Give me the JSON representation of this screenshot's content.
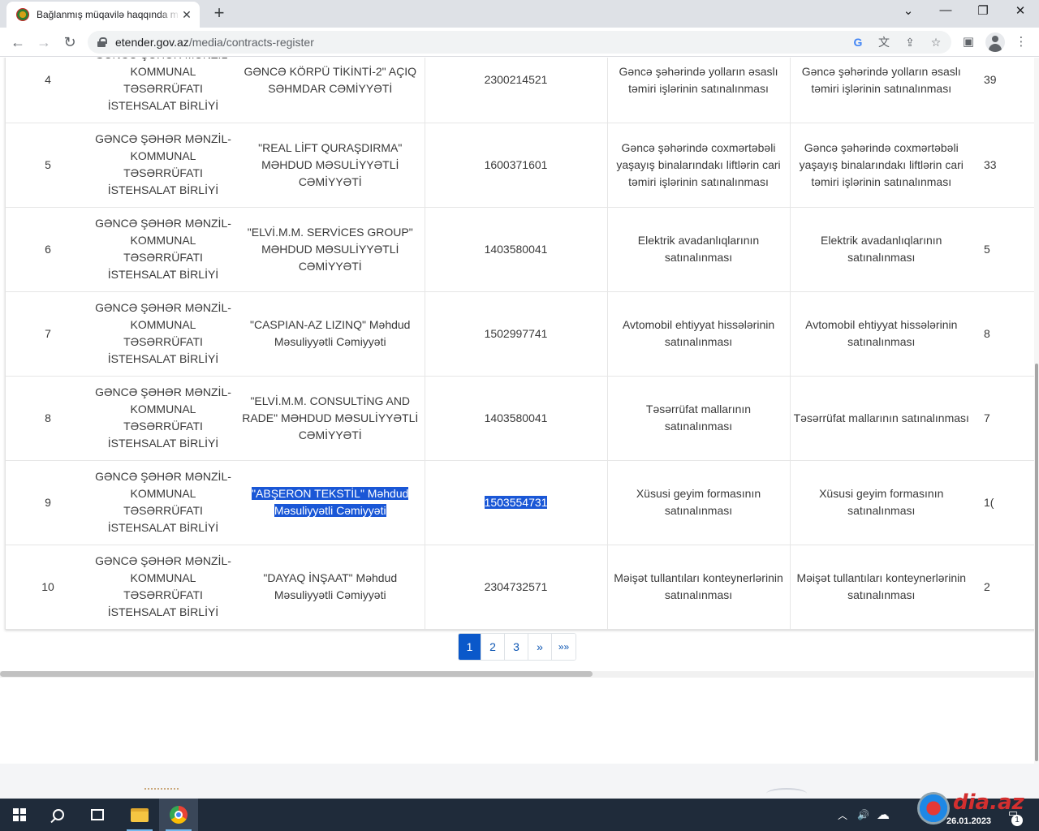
{
  "browser": {
    "tab_title": "Bağlanmış müqavilə haqqında m",
    "url_host": "etender.gov.az",
    "url_path": "/media/contracts-register",
    "close_glyph": "✕",
    "new_tab_glyph": "+",
    "minimize_glyph": "⌄",
    "min_glyph": "—",
    "restore_glyph": "❐",
    "window_close_glyph": "✕",
    "back_glyph": "←",
    "forward_glyph": "→",
    "reload_glyph": "↻",
    "menu_glyph": "⋮"
  },
  "rows": [
    {
      "num": "4",
      "customer": "GƏNCƏ ŞƏHƏR MƏNZİL-KOMMUNAL TƏSƏRRÜFATI İSTEHSALAT BİRLİYİ",
      "supplier": "GƏNCƏ KÖRPÜ TİKİNTİ-2\" AÇIQ SƏHMDAR CƏMİYYƏTİ",
      "voen": "2300214521",
      "subject": "Gəncə şəhərində yolların əsaslı təmiri işlərinin satınalınması",
      "description": "Gəncə şəhərində yolların əsaslı təmiri işlərinin satınalınması",
      "amount": "39"
    },
    {
      "num": "5",
      "customer": "GƏNCƏ ŞƏHƏR MƏNZİL-KOMMUNAL TƏSƏRRÜFATI İSTEHSALAT BİRLİYİ",
      "supplier": "\"REAL LİFT QURAŞDIRMA\" MƏHDUD MƏSULİYYƏTLİ CƏMİYYƏTİ",
      "voen": "1600371601",
      "subject": "Gəncə şəhərində coxmərtəbəli yaşayış binalarındakı liftlərin cari təmiri işlərinin satınalınması",
      "description": "Gəncə şəhərində coxmərtəbəli yaşayış binalarındakı liftlərin cari təmiri işlərinin satınalınması",
      "amount": "33"
    },
    {
      "num": "6",
      "customer": "GƏNCƏ ŞƏHƏR MƏNZİL-KOMMUNAL TƏSƏRRÜFATI İSTEHSALAT BİRLİYİ",
      "supplier": "\"ELVİ.M.M. SERVİCES GROUP\" MƏHDUD MƏSULİYYƏTLİ CƏMİYYƏTİ",
      "voen": "1403580041",
      "subject": "Elektrik avadanlıqlarının satınalınması",
      "description": "Elektrik avadanlıqlarının satınalınması",
      "amount": "5"
    },
    {
      "num": "7",
      "customer": "GƏNCƏ ŞƏHƏR MƏNZİL-KOMMUNAL TƏSƏRRÜFATI İSTEHSALAT BİRLİYİ",
      "supplier": "\"CASPIAN-AZ LIZINQ\" Məhdud Məsuliyyətli Cəmiyyəti",
      "voen": "1502997741",
      "subject": "Avtomobil ehtiyyat hissələrinin satınalınması",
      "description": "Avtomobil ehtiyyat hissələrinin satınalınması",
      "amount": "8"
    },
    {
      "num": "8",
      "customer": "GƏNCƏ ŞƏHƏR MƏNZİL-KOMMUNAL TƏSƏRRÜFATI İSTEHSALAT BİRLİYİ",
      "supplier": "\"ELVİ.M.M. CONSULTİNG AND RADE\" MƏHDUD MƏSULİYYƏTLİ CƏMİYYƏTİ",
      "voen": "1403580041",
      "subject": "Təsərrüfat mallarının satınalınması",
      "description": "Təsərrüfat mallarının satınalınması",
      "amount": "7"
    },
    {
      "num": "9",
      "customer": "GƏNCƏ ŞƏHƏR MƏNZİL-KOMMUNAL TƏSƏRRÜFATI İSTEHSALAT BİRLİYİ",
      "supplier": "\"ABŞERON TEKSTİL\" Məhdud Məsuliyyətli Cəmiyyəti",
      "voen": "1503554731",
      "subject": "Xüsusi geyim formasının satınalınması",
      "description": "Xüsusi geyim formasının satınalınması",
      "amount": "1("
    },
    {
      "num": "10",
      "customer": "GƏNCƏ ŞƏHƏR MƏNZİL-KOMMUNAL TƏSƏRRÜFATI İSTEHSALAT BİRLİYİ",
      "supplier": "\"DAYAQ İNŞAAT\" Məhdud Məsuliyyətli Cəmiyyəti",
      "voen": "2304732571",
      "subject": "Məişət tullantıları konteynerlərinin satınalınması",
      "description": "Məişət tullantıları konteynerlərinin satınalınması",
      "amount": "2"
    }
  ],
  "selection": {
    "supplier_line1": "\"ABŞERON TEKSTİL\" Məhdud",
    "supplier_line2": "Məsuliyyətli Cəmiyyəti"
  },
  "pagination": {
    "pages": [
      "1",
      "2",
      "3"
    ],
    "active": "1",
    "next": "»",
    "last": "»»"
  },
  "taskbar": {
    "watermark": "dia.az",
    "date": "26.01.2023",
    "notification_count": "1",
    "tray_chevron": "︿",
    "tray_volume": "🔊",
    "tray_cloud": "☁"
  }
}
